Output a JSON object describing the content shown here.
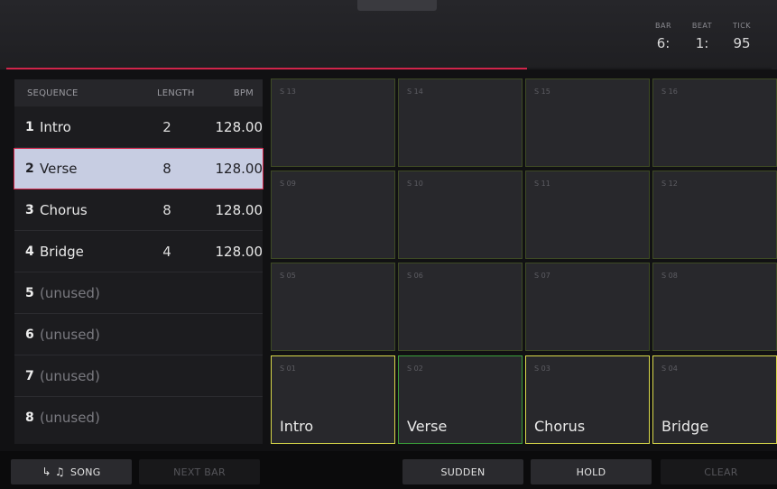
{
  "header": {
    "counters": {
      "bar": {
        "label": "BAR",
        "value": "6:"
      },
      "beat": {
        "label": "BEAT",
        "value": "1:"
      },
      "tick": {
        "label": "TICK",
        "value": "95"
      }
    },
    "progress": 0.68,
    "accent": "#d0254a"
  },
  "sequence_list": {
    "columns": {
      "name": "SEQUENCE",
      "length": "LENGTH",
      "bpm": "BPM"
    },
    "rows": [
      {
        "num": "1",
        "name": "Intro",
        "length": "2",
        "bpm": "128.00"
      },
      {
        "num": "2",
        "name": "Verse",
        "length": "8",
        "bpm": "128.00"
      },
      {
        "num": "3",
        "name": "Chorus",
        "length": "8",
        "bpm": "128.00"
      },
      {
        "num": "4",
        "name": "Bridge",
        "length": "4",
        "bpm": "128.00"
      },
      {
        "num": "5",
        "name": "(unused)",
        "length": "",
        "bpm": ""
      },
      {
        "num": "6",
        "name": "(unused)",
        "length": "",
        "bpm": ""
      },
      {
        "num": "7",
        "name": "(unused)",
        "length": "",
        "bpm": ""
      },
      {
        "num": "8",
        "name": "(unused)",
        "length": "",
        "bpm": ""
      }
    ],
    "selected_index": 1
  },
  "pads": [
    {
      "id": "S 13",
      "label": ""
    },
    {
      "id": "S 14",
      "label": ""
    },
    {
      "id": "S 15",
      "label": ""
    },
    {
      "id": "S 16",
      "label": ""
    },
    {
      "id": "S 09",
      "label": ""
    },
    {
      "id": "S 10",
      "label": ""
    },
    {
      "id": "S 11",
      "label": ""
    },
    {
      "id": "S 12",
      "label": ""
    },
    {
      "id": "S 05",
      "label": ""
    },
    {
      "id": "S 06",
      "label": ""
    },
    {
      "id": "S 07",
      "label": ""
    },
    {
      "id": "S 08",
      "label": ""
    },
    {
      "id": "S 01",
      "label": "Intro"
    },
    {
      "id": "S 02",
      "label": "Verse"
    },
    {
      "id": "S 03",
      "label": "Chorus"
    },
    {
      "id": "S 04",
      "label": "Bridge"
    }
  ],
  "footer": {
    "song_icon": "↳ ♫",
    "song": "SONG",
    "next_bar": "NEXT BAR",
    "sudden": "SUDDEN",
    "hold": "HOLD",
    "clear": "CLEAR"
  }
}
